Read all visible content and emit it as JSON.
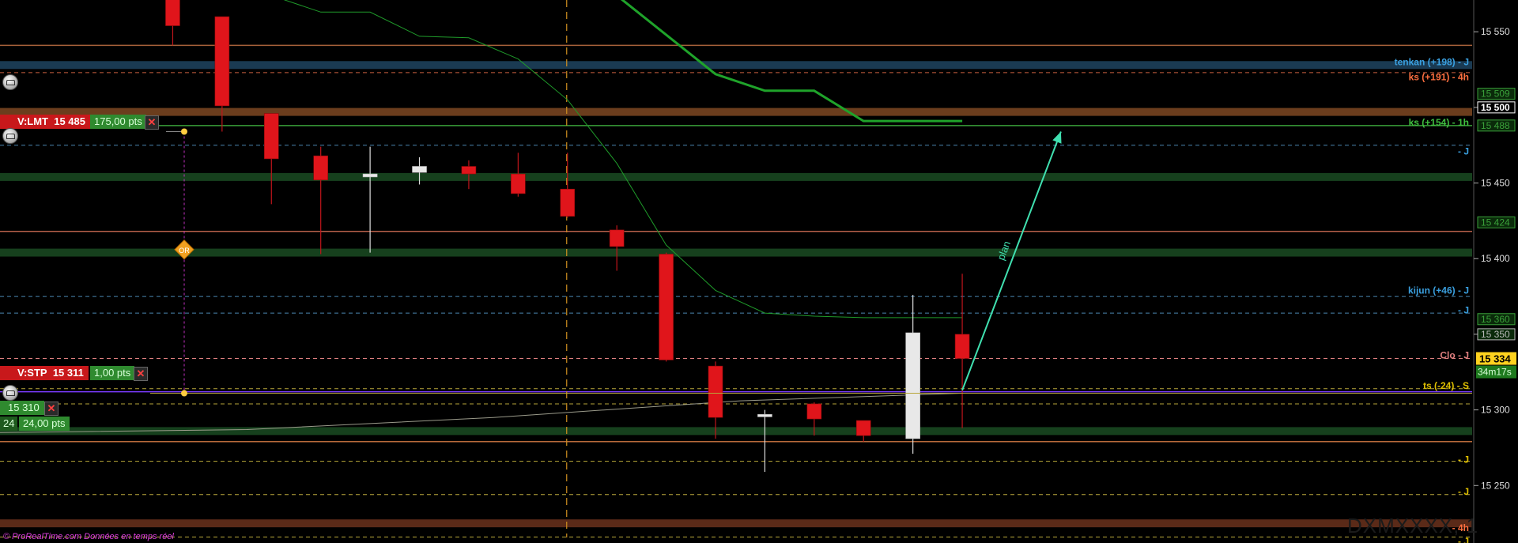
{
  "chart_data": {
    "type": "candlestick",
    "instrument_watermark": "DXMXXXX, 1",
    "y_ticks": [
      15550,
      15500,
      15450,
      15400,
      15350,
      15300,
      15250
    ],
    "y_tick_labels": [
      "15 550",
      "15 500",
      "15 450",
      "15 400",
      "15 350",
      "15 300",
      "15 250"
    ],
    "ylim": [
      15212,
      15571
    ],
    "xlim": [
      0,
      29
    ],
    "candles": [
      {
        "x": 3.5,
        "open": 15580,
        "close": 15554,
        "high": 15590,
        "low": 15541
      },
      {
        "x": 4.5,
        "open": 15560,
        "close": 15501,
        "high": 15560,
        "low": 15484
      },
      {
        "x": 5.5,
        "open": 15496,
        "close": 15466,
        "high": 15496,
        "low": 15436
      },
      {
        "x": 6.5,
        "open": 15468,
        "close": 15452,
        "high": 15474,
        "low": 15403
      },
      {
        "x": 7.5,
        "open": 15454,
        "close": 15456,
        "high": 15474,
        "low": 15404
      },
      {
        "x": 8.5,
        "open": 15457,
        "close": 15461,
        "high": 15467,
        "low": 15449
      },
      {
        "x": 9.5,
        "open": 15461,
        "close": 15456,
        "high": 15465,
        "low": 15446
      },
      {
        "x": 10.5,
        "open": 15456,
        "close": 15443,
        "high": 15470,
        "low": 15441
      },
      {
        "x": 11.5,
        "open": 15446,
        "close": 15428,
        "high": 15470,
        "low": 15427
      },
      {
        "x": 12.5,
        "open": 15419,
        "close": 15408,
        "high": 15422,
        "low": 15392
      },
      {
        "x": 13.5,
        "open": 15403,
        "close": 15333,
        "high": 15404,
        "low": 15332
      },
      {
        "x": 14.5,
        "open": 15329,
        "close": 15295,
        "high": 15332,
        "low": 15281
      },
      {
        "x": 15.5,
        "open": 15296,
        "close": 15297,
        "high": 15300,
        "low": 15259
      },
      {
        "x": 16.5,
        "open": 15304,
        "close": 15294,
        "high": 15305,
        "low": 15283
      },
      {
        "x": 17.5,
        "open": 15293,
        "close": 15283,
        "high": 15293,
        "low": 15279
      },
      {
        "x": 18.5,
        "open": 15281,
        "close": 15351,
        "high": 15376,
        "low": 15271
      },
      {
        "x": 19.5,
        "open": 15350,
        "close": 15334,
        "high": 15390,
        "low": 15288
      }
    ],
    "ichimoku_thick_line": [
      [
        12.5,
        15574
      ],
      [
        14.5,
        15522
      ],
      [
        15.5,
        15511
      ],
      [
        16.5,
        15511
      ],
      [
        17.5,
        15491
      ],
      [
        19.5,
        15491
      ]
    ],
    "ichimoku_thin_line": [
      [
        5.5,
        15574
      ],
      [
        6.5,
        15563
      ],
      [
        7.5,
        15563
      ],
      [
        8.5,
        15547
      ],
      [
        9.5,
        15546
      ],
      [
        10.5,
        15532
      ],
      [
        11.5,
        15505
      ],
      [
        12.5,
        15463
      ],
      [
        13.5,
        15409
      ],
      [
        14.5,
        15379
      ],
      [
        15.5,
        15364
      ],
      [
        16.5,
        15362
      ],
      [
        17.5,
        15361
      ],
      [
        19.5,
        15361
      ]
    ],
    "moving_average_line": [
      [
        0,
        15285
      ],
      [
        5,
        15287
      ],
      [
        10,
        15295
      ],
      [
        15,
        15306
      ],
      [
        19.5,
        15311
      ]
    ],
    "vertical_marker_x": 11.5,
    "plan_arrow": {
      "from": [
        19.5,
        15313
      ],
      "to": [
        21.5,
        15484
      ],
      "label": "plan"
    },
    "horizontal_bands": [
      {
        "price": 15528,
        "color": "#1a3a52"
      },
      {
        "price": 15497,
        "color": "#6b3d1d"
      },
      {
        "price": 15454,
        "color": "#16401d"
      },
      {
        "price": 15404,
        "color": "#16401d"
      },
      {
        "price": 15286,
        "color": "#16401d"
      },
      {
        "price": 15225,
        "color": "#5a2a18"
      }
    ],
    "horizontal_lines": [
      {
        "price": 15541,
        "color": "#a8623a",
        "style": "solid"
      },
      {
        "price": 15523,
        "color": "#c96040",
        "style": "dash"
      },
      {
        "price": 15488,
        "color": "#3aa03a",
        "style": "solid"
      },
      {
        "price": 15475,
        "color": "#4a86b0",
        "style": "dash"
      },
      {
        "price": 15418,
        "color": "#b8604a",
        "style": "solid"
      },
      {
        "price": 15375,
        "color": "#4a86b0",
        "style": "dash"
      },
      {
        "price": 15364,
        "color": "#4a86b0",
        "style": "dash"
      },
      {
        "price": 15334,
        "color": "#e08080",
        "style": "dash"
      },
      {
        "price": 15314,
        "color": "#b8a63a",
        "style": "dash"
      },
      {
        "price": 15312,
        "color": "#7a3aff",
        "style": "solid"
      },
      {
        "price": 15304,
        "color": "#b8a63a",
        "style": "dash"
      },
      {
        "price": 15279,
        "color": "#b86a3a",
        "style": "solid"
      },
      {
        "price": 15266,
        "color": "#b8a63a",
        "style": "dash"
      },
      {
        "price": 15244,
        "color": "#b8a63a",
        "style": "dash"
      },
      {
        "price": 15216,
        "color": "#b8a63a",
        "style": "dash"
      }
    ],
    "right_labels": [
      {
        "price": 15530,
        "text": "tenkan (+198) - J",
        "color": "#3aa0e0"
      },
      {
        "price": 15520,
        "text": "ks (+191) - 4h",
        "color": "#ff7040"
      },
      {
        "price": 15490,
        "text": "ks (+154) - 1h",
        "color": "#40c040"
      },
      {
        "price": 15471,
        "text": "- J",
        "color": "#3aa0e0"
      },
      {
        "price": 15379,
        "text": "kijun (+46) - J",
        "color": "#3aa0e0"
      },
      {
        "price": 15366,
        "text": "- J",
        "color": "#3aa0e0"
      },
      {
        "price": 15336,
        "text": "Clo - J",
        "color": "#e08080"
      },
      {
        "price": 15316,
        "text": "ts (-24) - S",
        "color": "#e0c000"
      },
      {
        "price": 15267,
        "text": "- J",
        "color": "#e0c000"
      },
      {
        "price": 15246,
        "text": "- J",
        "color": "#e0c000"
      },
      {
        "price": 15222,
        "text": "- 4h",
        "color": "#ff7040"
      },
      {
        "price": 15213,
        "text": "- J",
        "color": "#e0c000"
      }
    ],
    "axis_boxes": [
      {
        "price": 15509,
        "text": "15 509",
        "color": "#3aa03a"
      },
      {
        "price": 15500,
        "text": "15 500",
        "color": "#ffffff"
      },
      {
        "price": 15488,
        "text": "15 488",
        "color": "#3aa03a"
      },
      {
        "price": 15424,
        "text": "15 424",
        "color": "#3aa03a"
      },
      {
        "price": 15360,
        "text": "15 360",
        "color": "#3aa03a"
      },
      {
        "price": 15350,
        "text": "15 350",
        "color": "#bbbbbb"
      }
    ],
    "current_price": {
      "price": 15334,
      "label": "15 334",
      "timer": "34m17s"
    }
  },
  "orders": {
    "limit": {
      "label": "V:LMT",
      "price": "15 485",
      "pts": "175,00 pts"
    },
    "stop": {
      "label": "V:STP",
      "price": "15 311",
      "pts": "1,00 pts"
    },
    "position": {
      "price": "15 310",
      "qty": "24",
      "pts": "24,00 pts"
    },
    "or_marker": "OR"
  },
  "footer": "© ProRealTime.com  Données en temps réel"
}
